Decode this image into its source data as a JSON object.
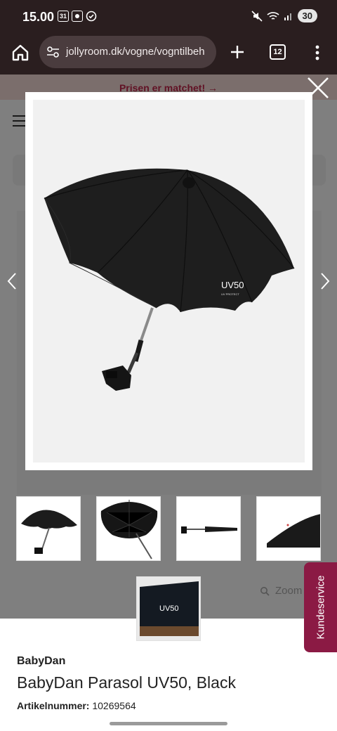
{
  "status_bar": {
    "time": "15.00",
    "calendar_badge": "31",
    "battery": "30"
  },
  "browser": {
    "url": "jollyroom.dk/vogne/vogntilbeh",
    "tab_count": "12"
  },
  "page": {
    "promo_text": "Prisen er matchet! →",
    "zoom_label": "Zoom",
    "brand": "BabyDan",
    "product_title": "BabyDan Parasol UV50, Black",
    "sku_label": "Artikelnummer:",
    "sku_value": "10269564",
    "service_tab": "Kundeservice"
  },
  "modal": {
    "umbrella_print": "UV50",
    "umbrella_subprint": "UV PROTECT"
  },
  "thumbnails": [
    {
      "name": "side-view"
    },
    {
      "name": "underside-view"
    },
    {
      "name": "folded-view"
    },
    {
      "name": "edge-detail-view"
    },
    {
      "name": "print-detail-view"
    }
  ]
}
